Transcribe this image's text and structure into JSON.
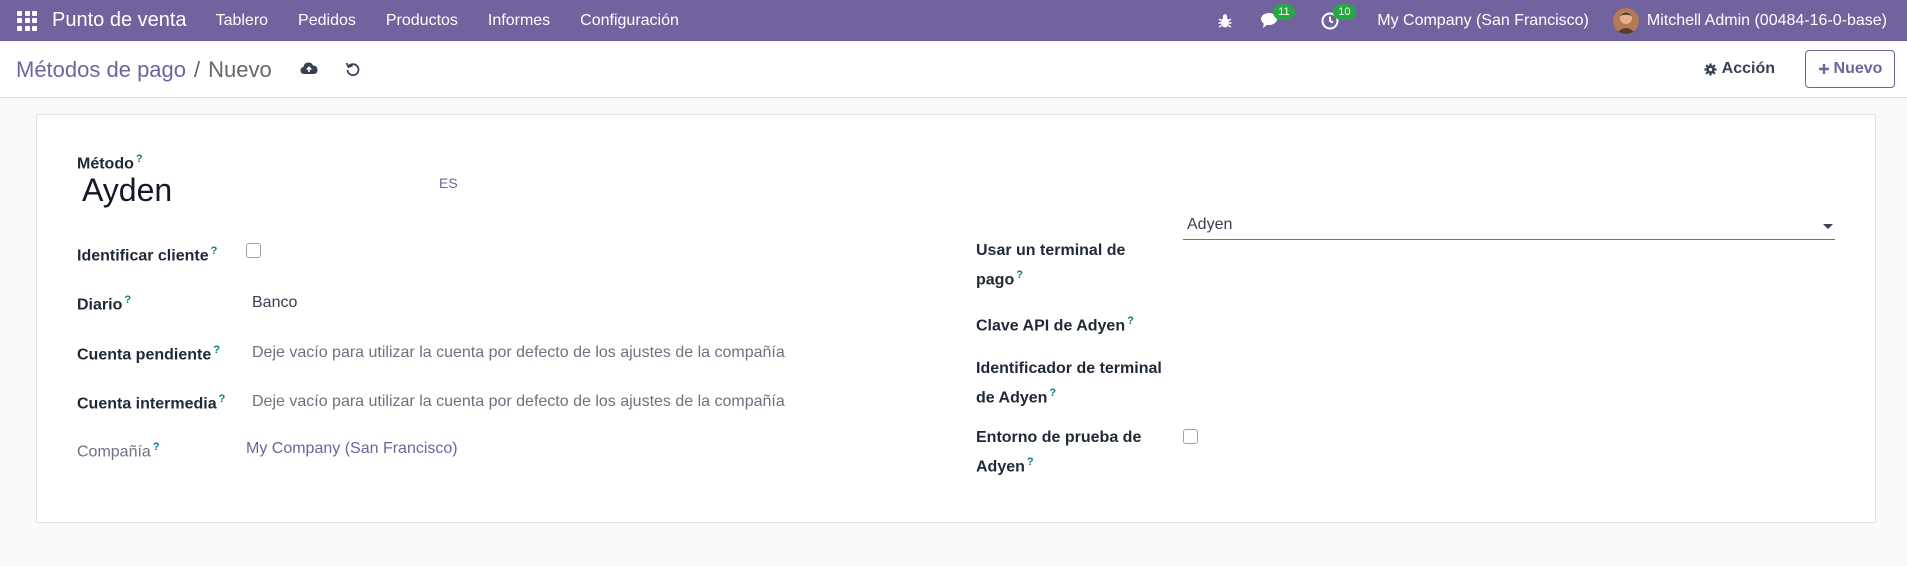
{
  "navbar": {
    "brand": "Punto de venta",
    "menu": [
      "Tablero",
      "Pedidos",
      "Productos",
      "Informes",
      "Configuración"
    ],
    "messages_count": "11",
    "activities_count": "10",
    "company": "My Company (San Francisco)",
    "user": "Mitchell Admin (00484-16-0-base)"
  },
  "control": {
    "breadcrumb_parent": "Métodos de pago",
    "breadcrumb_sep": "/",
    "breadcrumb_current": "Nuevo",
    "action_label": "Acción",
    "new_label": "Nuevo"
  },
  "form": {
    "method_label": "Método",
    "method_value": "Ayden",
    "lang": "ES",
    "identify_customer_label": "Identificar cliente",
    "journal_label": "Diario",
    "journal_value": "Banco",
    "receivable_label": "Cuenta pendiente",
    "receivable_placeholder": "Deje vacío para utilizar la cuenta por defecto de los ajustes de la compañía",
    "intermediary_label": "Cuenta intermedia",
    "intermediary_placeholder": "Deje vacío para utilizar la cuenta por defecto de los ajustes de la compañía",
    "company_label": "Compañía",
    "company_value": "My Company (San Francisco)",
    "terminal_label_1": "Usar un terminal de",
    "terminal_label_2": "pago",
    "terminal_value": "Adyen",
    "api_key_label": "Clave API de Adyen",
    "terminal_id_label_1": "Identificador de terminal",
    "terminal_id_label_2": "de Adyen",
    "test_env_label_1": "Entorno de prueba de",
    "test_env_label_2": "Adyen",
    "help_mark": "?"
  }
}
